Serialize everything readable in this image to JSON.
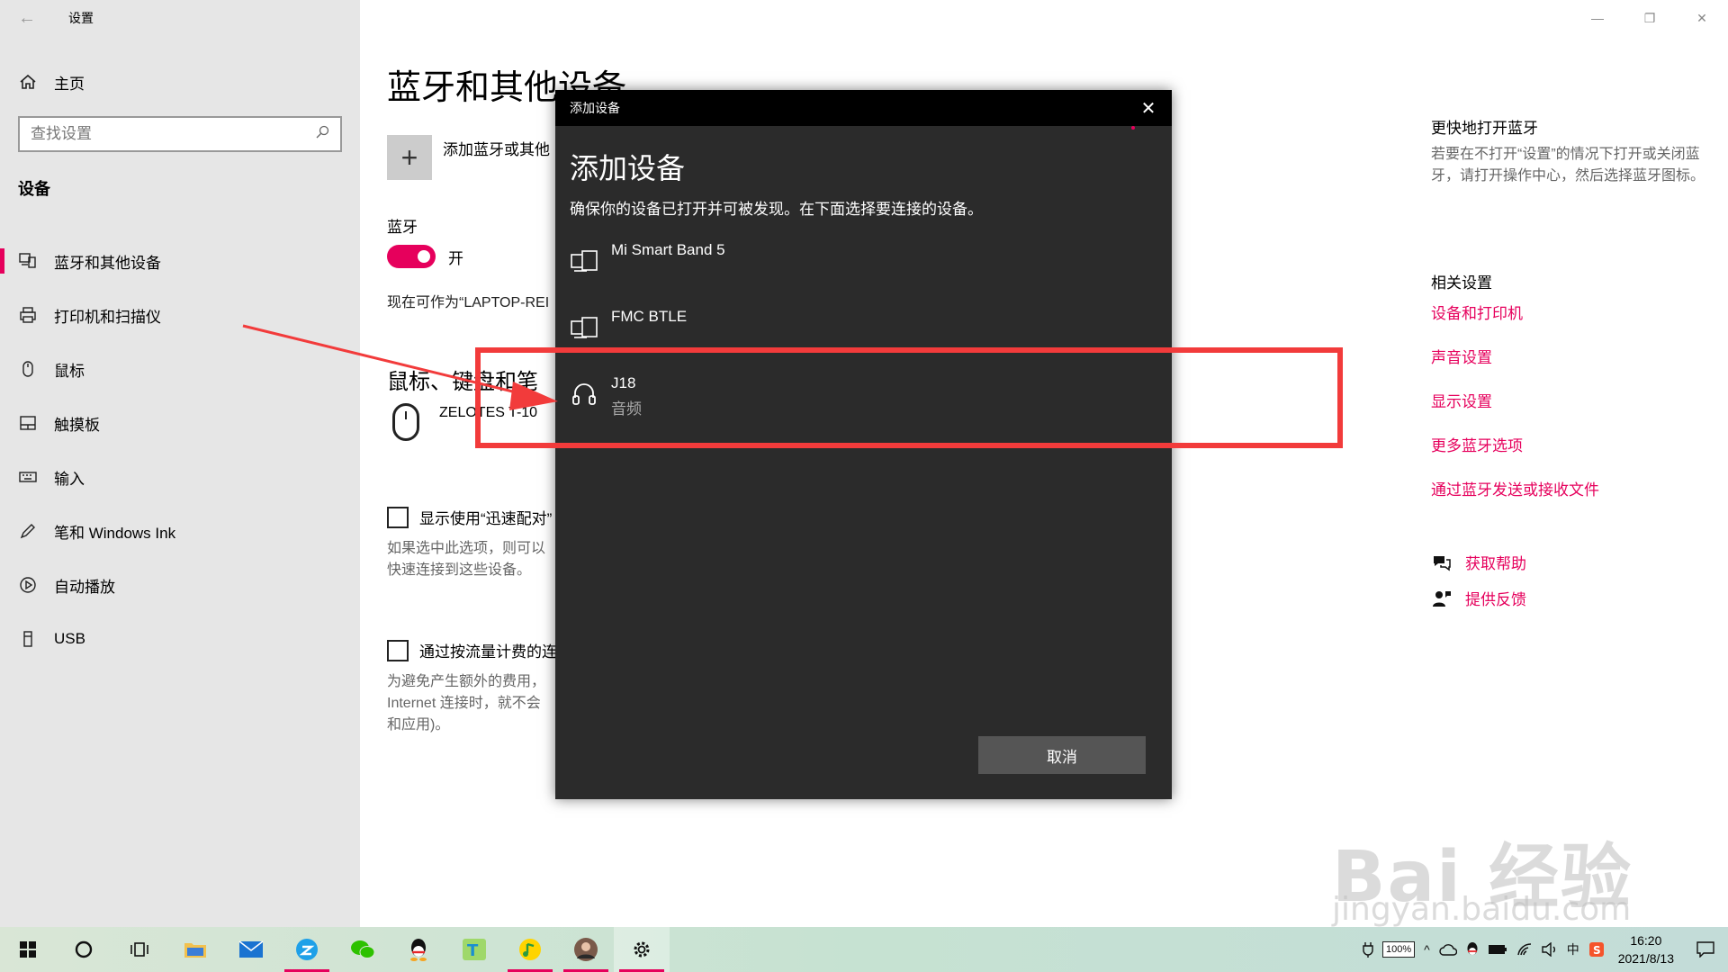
{
  "window": {
    "title": "设置",
    "controls": [
      "minimize",
      "restore",
      "close"
    ]
  },
  "sidebar": {
    "home_label": "主页",
    "search_placeholder": "查找设置",
    "section_label": "设备",
    "items": [
      {
        "label": "蓝牙和其他设备",
        "icon": "bluetooth-devices-icon",
        "active": true
      },
      {
        "label": "打印机和扫描仪",
        "icon": "printer-icon"
      },
      {
        "label": "鼠标",
        "icon": "mouse-icon"
      },
      {
        "label": "触摸板",
        "icon": "touchpad-icon"
      },
      {
        "label": "输入",
        "icon": "keyboard-icon"
      },
      {
        "label": "笔和 Windows Ink",
        "icon": "pen-icon"
      },
      {
        "label": "自动播放",
        "icon": "autoplay-icon"
      },
      {
        "label": "USB",
        "icon": "usb-icon"
      }
    ]
  },
  "main": {
    "page_title": "蓝牙和其他设备",
    "add_device_label": "添加蓝牙或其他",
    "bluetooth_label": "蓝牙",
    "toggle_state": "开",
    "discoverable_text": "现在可作为“LAPTOP-REI",
    "mouse_section_title": "鼠标、键盘和笔",
    "mouse_device_name": "ZELOTES T-10",
    "swift_pair_label": "显示使用“迅速配对”",
    "swift_pair_desc_1": "如果选中此选项，则可以",
    "swift_pair_desc_2": "快速连接到这些设备。",
    "metered_label": "通过按流量计费的连",
    "metered_desc_1": "为避免产生额外的费用，",
    "metered_desc_2": "Internet 连接时，就不会",
    "metered_desc_3": "和应用)。"
  },
  "right_col": {
    "quick_title": "更快地打开蓝牙",
    "quick_text": "若要在不打开“设置”的情况下打开或关闭蓝牙，请打开操作中心，然后选择蓝牙图标。",
    "related_title": "相关设置",
    "links": [
      "设备和打印机",
      "声音设置",
      "显示设置",
      "更多蓝牙选项",
      "通过蓝牙发送或接收文件"
    ],
    "help_label": "获取帮助",
    "feedback_label": "提供反馈"
  },
  "dialog": {
    "titlebar": "添加设备",
    "heading": "添加设备",
    "description": "确保你的设备已打开并可被发现。在下面选择要连接的设备。",
    "devices": [
      {
        "name": "Mi Smart Band 5",
        "sub": "",
        "icon": "device-icon"
      },
      {
        "name": "FMC BTLE",
        "sub": "",
        "icon": "device-icon"
      },
      {
        "name": "J18",
        "sub": "音频",
        "icon": "headphones-icon"
      }
    ],
    "cancel_label": "取消"
  },
  "watermark": {
    "main": "Bai 经验",
    "sub": "jingyan.baidu.com"
  },
  "taskbar": {
    "apps": [
      "start-icon",
      "cortana-icon",
      "task-view-icon",
      "file-explorer-icon",
      "mail-icon",
      "browser-icon",
      "wechat-icon",
      "qq-icon",
      "app-t-icon",
      "music-icon",
      "avatar-app-icon",
      "settings-icon"
    ],
    "battery": "100%",
    "ime": "中",
    "time": "16:20",
    "date": "2021/8/13"
  },
  "colors": {
    "accent": "#e6005c",
    "annotation": "#f23b3b",
    "dialog_bg": "#2b2b2b"
  }
}
